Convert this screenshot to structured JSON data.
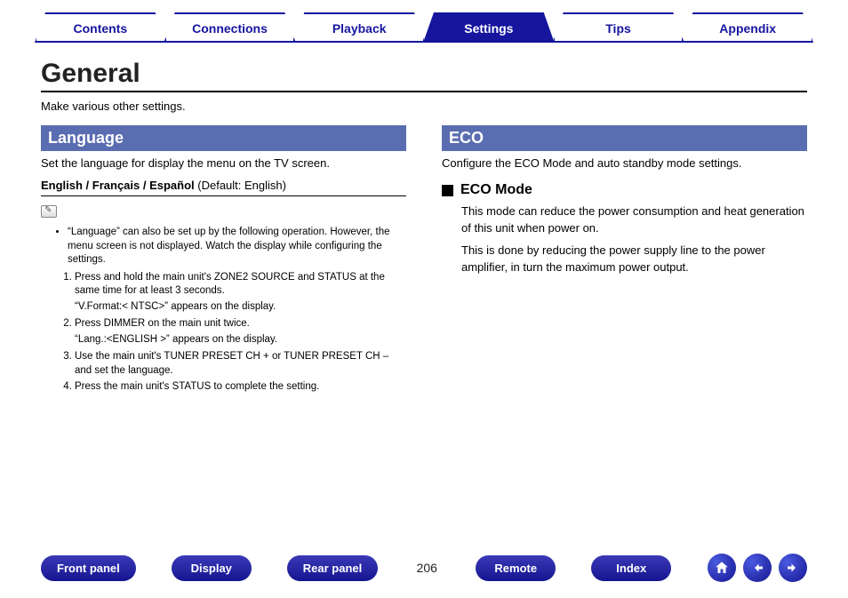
{
  "tabs": [
    {
      "label": "Contents",
      "active": false
    },
    {
      "label": "Connections",
      "active": false
    },
    {
      "label": "Playback",
      "active": false
    },
    {
      "label": "Settings",
      "active": true
    },
    {
      "label": "Tips",
      "active": false
    },
    {
      "label": "Appendix",
      "active": false
    }
  ],
  "page": {
    "title": "General",
    "subtitle": "Make various other settings.",
    "number": "206"
  },
  "language": {
    "header": "Language",
    "desc": "Set the language for display the menu on the TV screen.",
    "options_bold": "English / Français / Español",
    "options_default": " (Default: English)",
    "note_intro": "“Language” can also be set up by the following operation. However, the menu screen is not displayed. Watch the display while configuring the settings.",
    "steps": [
      {
        "text": "Press and hold the main unit's ZONE2 SOURCE and STATUS at the same time for at least 3 seconds.",
        "after": "“V.Format:< NTSC>” appears on the display."
      },
      {
        "text": "Press DIMMER on the main unit twice.",
        "after": "“Lang.:<ENGLISH >” appears on the display."
      },
      {
        "text": "Use the main unit's TUNER PRESET CH + or TUNER PRESET CH – and set the language.",
        "after": ""
      },
      {
        "text": "Press the main unit's STATUS to complete the setting.",
        "after": ""
      }
    ]
  },
  "eco": {
    "header": "ECO",
    "desc": "Configure the ECO Mode and auto standby mode settings.",
    "sub_header": "ECO Mode",
    "para1": "This mode can reduce the power consumption and heat generation of this unit when power on.",
    "para2": "This is done by reducing the power supply line to the power amplifier, in turn the maximum power output."
  },
  "footer": {
    "buttons": [
      "Front panel",
      "Display",
      "Rear panel"
    ],
    "buttons_right": [
      "Remote",
      "Index"
    ]
  }
}
